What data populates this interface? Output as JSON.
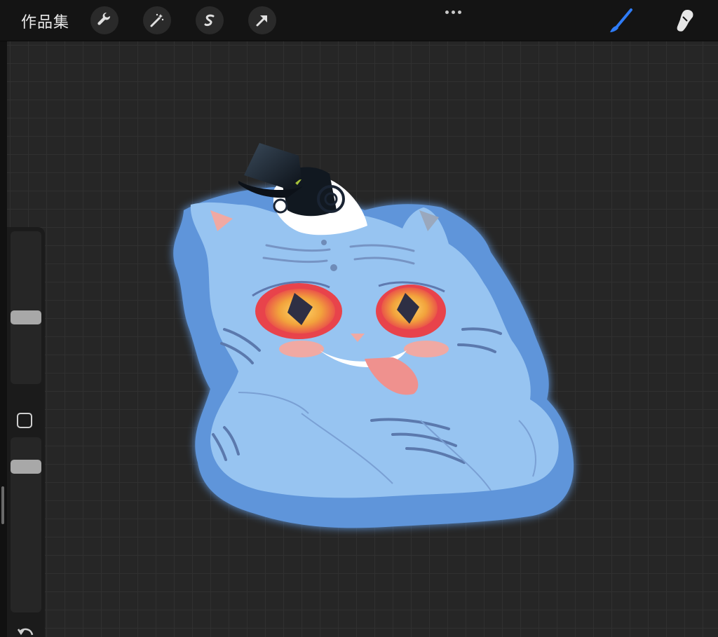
{
  "toolbar": {
    "gallery_label": "作品集",
    "left_tools": [
      {
        "icon": "wrench-icon",
        "name": "actions"
      },
      {
        "icon": "magic-wand-icon",
        "name": "adjustments"
      },
      {
        "icon": "selection-s-icon",
        "name": "selection"
      },
      {
        "icon": "arrow-cursor-icon",
        "name": "transform"
      }
    ],
    "more_icon": "ellipsis-icon",
    "right_tools": [
      {
        "icon": "brush-icon",
        "name": "paint",
        "active": true
      },
      {
        "icon": "smudge-finger-icon",
        "name": "smudge",
        "active": false
      }
    ]
  },
  "sidebar": {
    "brush_size_level": 0.55,
    "opacity_level": 0.65,
    "modify_icon": "square-modify-icon",
    "undo_icon": "undo-arrow-icon"
  },
  "colors": {
    "accent": "#2f7cf6",
    "canvas_bg": "#262626",
    "grid_line": "#303030",
    "toolbar_bg": "#141414"
  },
  "artwork": {
    "subject": "blue-tiger-sticker-illustration"
  }
}
